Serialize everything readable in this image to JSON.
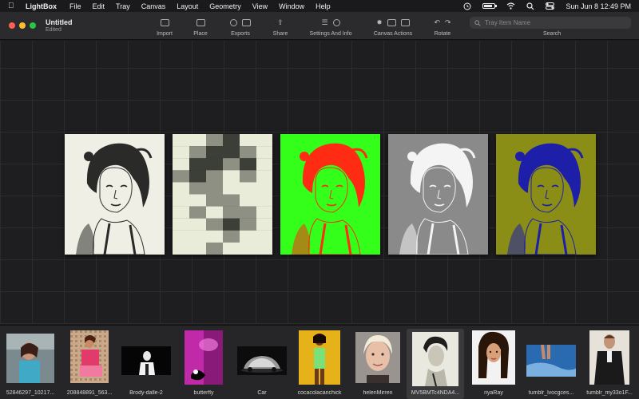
{
  "menubar": {
    "apple_icon": "apple-icon",
    "app_name": "LightBox",
    "items": [
      "File",
      "Edit",
      "Tray",
      "Canvas",
      "Layout",
      "Geometry",
      "View",
      "Window",
      "Help"
    ],
    "clock": "Sun Jun 8  12:49 PM",
    "battery_level": 0.8
  },
  "window": {
    "title": "Untitled",
    "subtitle": "Edited"
  },
  "toolbar": {
    "import_label": "Import",
    "place_label": "Place",
    "exports_label": "Exports",
    "share_label": "Share",
    "settings_label": "Settings And Info",
    "canvas_actions_label": "Canvas Actions",
    "rotate_label": "Rotate",
    "search_label": "Search",
    "search_placeholder": "Tray Item Name",
    "search_value": ""
  },
  "canvas": {
    "photos": [
      {
        "effect": "sepia-sketch",
        "colors": [
          "#efefe6",
          "#2a2a28"
        ]
      },
      {
        "effect": "pixelated",
        "colors": [
          "#e9ecd8",
          "#3c3e38"
        ]
      },
      {
        "effect": "red-on-green",
        "colors": [
          "#33ff1a",
          "#ff2b12"
        ]
      },
      {
        "effect": "grey-posterized",
        "colors": [
          "#8a8a8a",
          "#f4f4f4"
        ]
      },
      {
        "effect": "blue-on-olive",
        "colors": [
          "#8a8d16",
          "#1d1fa8"
        ]
      }
    ]
  },
  "tray": {
    "items": [
      {
        "label": "52846297_10217...",
        "selected": false
      },
      {
        "label": "208848891_563...",
        "selected": false
      },
      {
        "label": "Brody-dalle-2",
        "selected": false
      },
      {
        "label": "butterfly",
        "selected": false
      },
      {
        "label": "Car",
        "selected": false
      },
      {
        "label": "cocacolacanchick",
        "selected": false
      },
      {
        "label": "helenMirren",
        "selected": false
      },
      {
        "label": "MV5BMTc4NDA4...",
        "selected": true
      },
      {
        "label": "riyaRay",
        "selected": false
      },
      {
        "label": "tumblr_lvocgces...",
        "selected": false
      },
      {
        "label": "tumblr_my33o1F...",
        "selected": false
      }
    ]
  }
}
